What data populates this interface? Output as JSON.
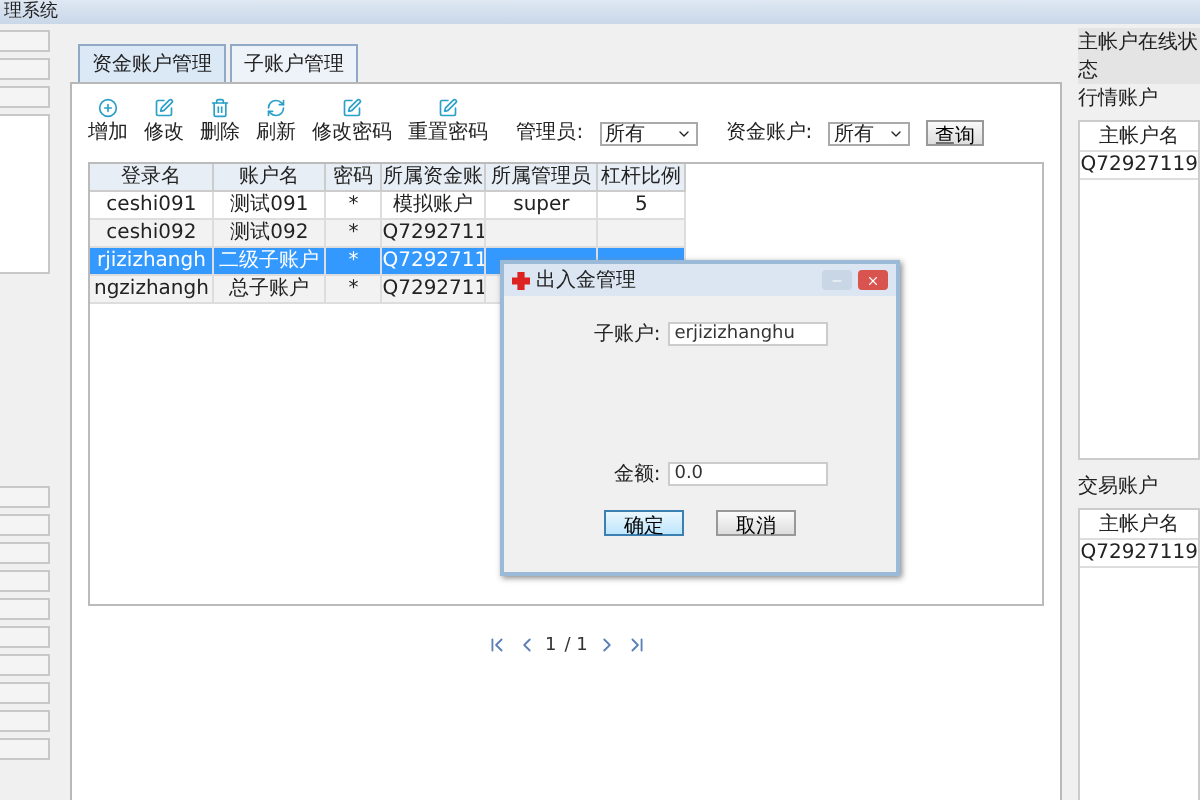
{
  "window": {
    "title": "理系统"
  },
  "tabs": [
    {
      "label": "资金账户管理",
      "selected": true
    },
    {
      "label": "子账户管理",
      "selected": false
    }
  ],
  "toolbar": [
    {
      "kind": "add",
      "label": "增加"
    },
    {
      "kind": "edit",
      "label": "修改"
    },
    {
      "kind": "delete",
      "label": "删除"
    },
    {
      "kind": "refresh",
      "label": "刷新"
    },
    {
      "kind": "edit",
      "label": "修改密码"
    },
    {
      "kind": "edit",
      "label": "重置密码"
    }
  ],
  "filters": [
    {
      "label": "管理员:",
      "value": "所有"
    },
    {
      "label": "资金账户:",
      "value": "所有"
    }
  ],
  "query_button": "查询",
  "table": {
    "columns": [
      "登录名",
      "账户名",
      "密码",
      "所属资金账",
      "所属管理员",
      "杠杆比例"
    ],
    "rows": [
      {
        "selected": false,
        "cells": [
          "ceshi091",
          "测试091",
          "*",
          "模拟账户",
          "super",
          "5"
        ]
      },
      {
        "selected": false,
        "cells": [
          "ceshi092",
          "测试092",
          "*",
          "Q7292711",
          "",
          ""
        ]
      },
      {
        "selected": true,
        "cells": [
          "rjizizhangh",
          "二级子账户",
          "*",
          "Q7292711",
          "",
          ""
        ]
      },
      {
        "selected": false,
        "cells": [
          "ngzizhangh",
          "总子账户",
          "*",
          "Q7292711",
          "",
          ""
        ]
      }
    ]
  },
  "pagination": {
    "page": "1",
    "total": "/ 1"
  },
  "dialog": {
    "title": "出入金管理",
    "fields": [
      {
        "label": "子账户:",
        "value": "erjizizhanghu"
      },
      {
        "label": "金额:",
        "value": "0.0"
      }
    ],
    "buttons": [
      "确定",
      "取消"
    ]
  },
  "right_panel": {
    "title": "主帐户在线状态",
    "sections": [
      {
        "title": "行情账户",
        "column": "主帐户名",
        "rows": [
          "Q72927119"
        ]
      },
      {
        "title": "交易账户",
        "column": "主帐户名",
        "rows": [
          "Q72927119"
        ]
      }
    ]
  }
}
